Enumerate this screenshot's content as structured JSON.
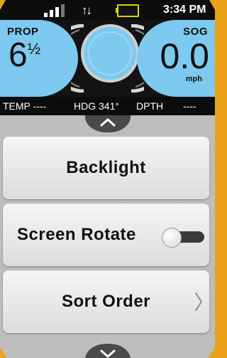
{
  "status": {
    "time": "3:34 PM",
    "signal_bars": 4,
    "signal_bars_lit": 3
  },
  "gauges": {
    "prop_label": "PROP",
    "prop_value": "6",
    "prop_fraction": "½",
    "sog_label": "SOG",
    "sog_value": "0.0",
    "sog_unit": "mph"
  },
  "info": {
    "temp": "TEMP ----",
    "hdg": "HDG 341°",
    "dpth_label": "DPTH",
    "dpth_value": "----"
  },
  "menu": {
    "items": [
      {
        "label": "Backlight"
      },
      {
        "label": "Screen Rotate",
        "toggle_on": false
      },
      {
        "label": "Sort Order"
      }
    ]
  },
  "colors": {
    "gauge_blue": "#7ec9f0",
    "accent_orange": "#e9a21a",
    "menu_bg": "#bdbdbd"
  }
}
